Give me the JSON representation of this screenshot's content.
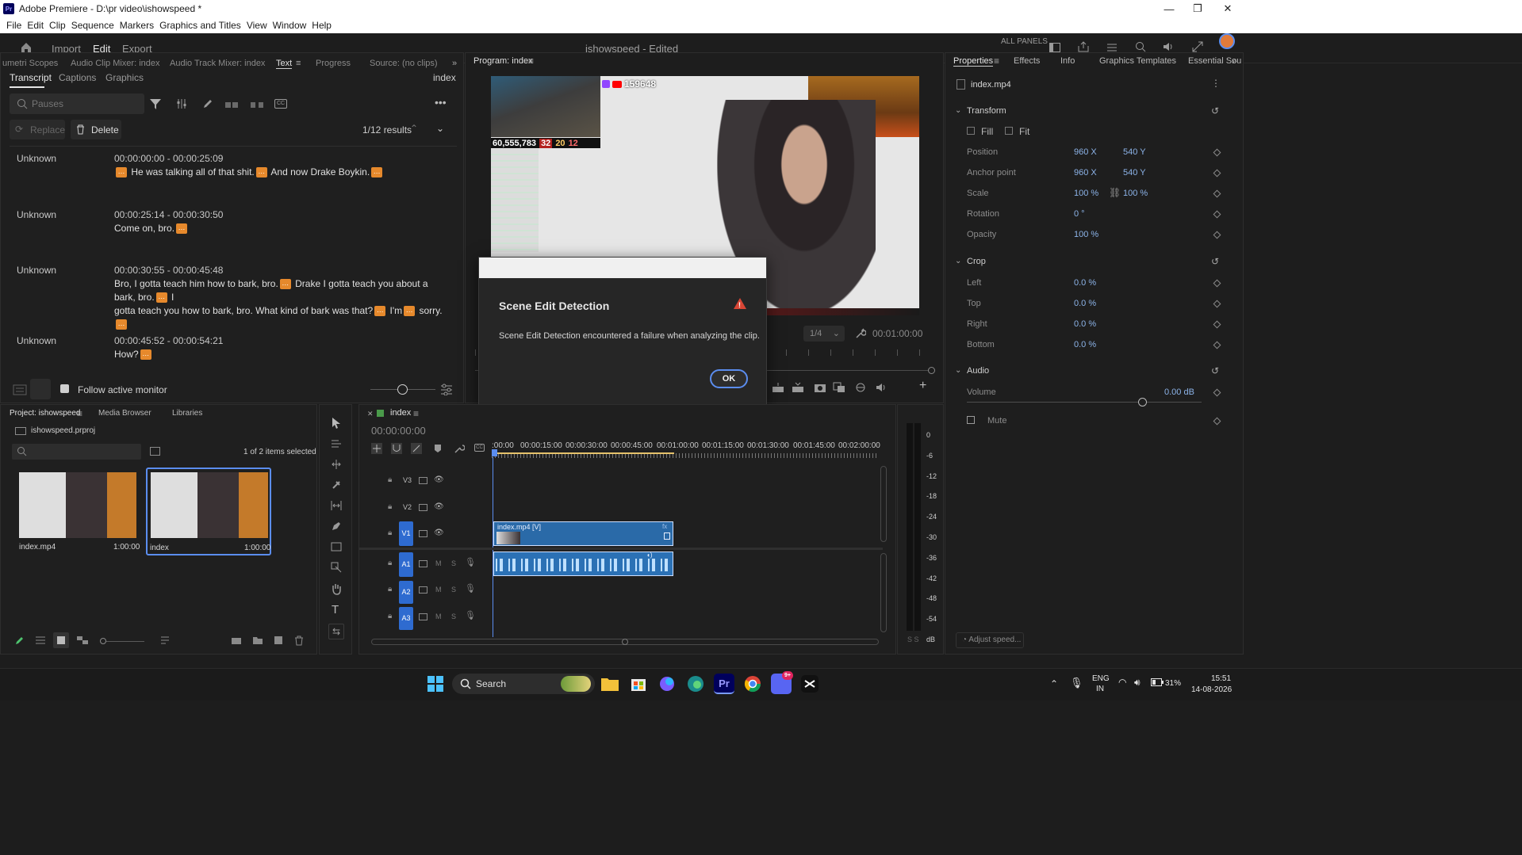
{
  "window": {
    "title": "Adobe Premiere - D:\\pr video\\ishowspeed *",
    "app_icon": "Pr",
    "controls": [
      "—",
      "❐",
      "✕"
    ]
  },
  "menu": [
    "File",
    "Edit",
    "Clip",
    "Sequence",
    "Markers",
    "Graphics and Titles",
    "View",
    "Window",
    "Help"
  ],
  "header": {
    "tabs": [
      "Import",
      "Edit",
      "Export"
    ],
    "active_tab": "Edit",
    "project_title": "ishowspeed - Edited",
    "all_panels": "ALL PANELS"
  },
  "left_panel": {
    "tabs": [
      "umetri Scopes",
      "Audio Clip Mixer: index",
      "Audio Track Mixer: index",
      "Text",
      "Progress",
      "Source: (no clips)"
    ],
    "subtabs": [
      "Transcript",
      "Captions",
      "Graphics"
    ],
    "sequence_name": "index",
    "search_placeholder": "Pauses",
    "replace_label": "Replace",
    "delete_label": "Delete",
    "results": "1/12 results",
    "segments": [
      {
        "speaker": "Unknown",
        "time": "00:00:00:00 - 00:00:25:09",
        "lines": [
          " He was talking all of that shit.",
          " And now Drake Boykin."
        ]
      },
      {
        "speaker": "Unknown",
        "time": "00:00:25:14 - 00:00:30:50",
        "lines": [
          "Come on, bro."
        ]
      },
      {
        "speaker": "Unknown",
        "time": "00:00:30:55 - 00:00:45:48",
        "lines": [
          "Bro, I gotta teach him how to bark, bro.",
          " Drake I gotta teach you about a bark, bro.",
          " I",
          "gotta teach you how to bark, bro. What kind of bark was that?",
          " I'm",
          " sorry."
        ]
      },
      {
        "speaker": "Unknown",
        "time": "00:00:45:52 - 00:00:54:21",
        "lines": [
          "How?"
        ]
      }
    ],
    "badge_glyph": "…",
    "follow_label": "Follow active monitor"
  },
  "program_monitor": {
    "title": "Program: index",
    "viewer_count": "159648",
    "stats": [
      "60,555,783",
      "32",
      "20",
      "12"
    ],
    "zoom": "1/4",
    "timecode": "00:01:00:00"
  },
  "dialog": {
    "title": "Scene Edit Detection",
    "message": "Scene Edit Detection encountered a failure when analyzing the clip.",
    "ok": "OK",
    "warning_glyph": "!"
  },
  "properties": {
    "tabs": [
      "Properties",
      "Effects",
      "Info",
      "Graphics Templates",
      "Essential Sou"
    ],
    "clip": "index.mp4",
    "transform": {
      "title": "Transform",
      "fill": "Fill",
      "fit": "Fit",
      "rows": [
        {
          "label": "Position",
          "v1": "960 X",
          "v2": "540 Y"
        },
        {
          "label": "Anchor point",
          "v1": "960 X",
          "v2": "540 Y"
        },
        {
          "label": "Scale",
          "v1": "100 %",
          "v2": "100 %"
        },
        {
          "label": "Rotation",
          "v1": "0 °",
          "v2": ""
        },
        {
          "label": "Opacity",
          "v1": "100 %",
          "v2": ""
        }
      ]
    },
    "crop": {
      "title": "Crop",
      "rows": [
        {
          "label": "Left",
          "v1": "0.0 %"
        },
        {
          "label": "Top",
          "v1": "0.0 %"
        },
        {
          "label": "Right",
          "v1": "0.0 %"
        },
        {
          "label": "Bottom",
          "v1": "0.0 %"
        }
      ]
    },
    "audio": {
      "title": "Audio",
      "volume_label": "Volume",
      "volume_value": "0.00 dB",
      "volume_level": 0.75,
      "mute_label": "Mute"
    },
    "adjust_speed": "Adjust speed..."
  },
  "project_panel": {
    "tabs": [
      "Project: ishowspeed",
      "Media Browser",
      "Libraries"
    ],
    "project_file": "ishowspeed.prproj",
    "selection": "1 of 2 items selected",
    "items": [
      {
        "name": "index.mp4",
        "duration": "1:00:00"
      },
      {
        "name": "index",
        "duration": "1:00:00"
      }
    ]
  },
  "timeline": {
    "sequence": "index",
    "timecode": "00:00:00:00",
    "ruler": [
      ":00:00",
      "00:00:15:00",
      "00:00:30:00",
      "00:00:45:00",
      "00:01:00:00",
      "00:01:15:00",
      "00:01:30:00",
      "00:01:45:00",
      "00:02:00:00"
    ],
    "video_tracks": [
      "V3",
      "V2",
      "V1"
    ],
    "audio_tracks": [
      "A1",
      "A2",
      "A3"
    ],
    "video_clip": "index.mp4 [V]",
    "track_mute": "M",
    "track_solo": "S"
  },
  "meter": {
    "scale": [
      "0",
      "-6",
      "-12",
      "-18",
      "-24",
      "-30",
      "-36",
      "-42",
      "-48",
      "-54",
      "dB"
    ],
    "footer": "S S"
  },
  "taskbar": {
    "search": "Search",
    "lang": "ENG",
    "region": "IN",
    "battery": "31%",
    "time": "15:51",
    "date": "14-08-2026",
    "discord_badge": "9+"
  }
}
